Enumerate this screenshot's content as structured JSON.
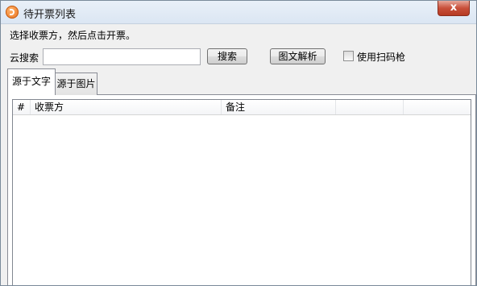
{
  "window": {
    "title": "待开票列表",
    "close_label": "x"
  },
  "instruction": "选择收票方，然后点击开票。",
  "search": {
    "label": "云搜索",
    "value": "",
    "placeholder": "",
    "search_button": "搜索",
    "parse_button": "图文解析"
  },
  "scanner": {
    "label": "使用扫码枪",
    "checked": false
  },
  "tabs": [
    {
      "label": "源于文字",
      "active": true
    },
    {
      "label": "源于图片",
      "active": false
    }
  ],
  "table": {
    "columns": [
      "#",
      "收票方",
      "备注",
      "",
      ""
    ],
    "rows": []
  },
  "colors": {
    "titlebar": "#dbe6f3",
    "close_button": "#c8503a",
    "window_bg": "#f0f0f0"
  }
}
